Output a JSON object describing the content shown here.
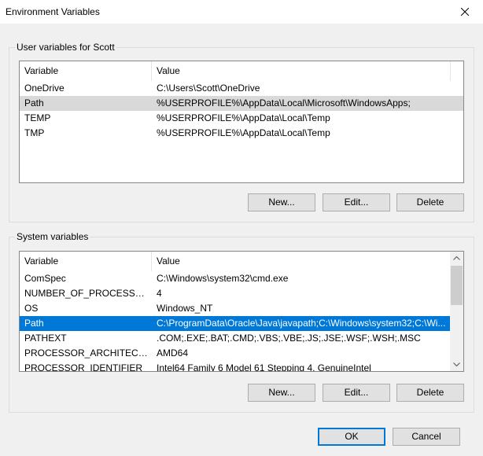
{
  "window": {
    "title": "Environment Variables"
  },
  "user_group": {
    "label": "User variables for Scott",
    "columns": [
      "Variable",
      "Value"
    ],
    "rows": [
      {
        "variable": "OneDrive",
        "value": "C:\\Users\\Scott\\OneDrive"
      },
      {
        "variable": "Path",
        "value": "%USERPROFILE%\\AppData\\Local\\Microsoft\\WindowsApps;"
      },
      {
        "variable": "TEMP",
        "value": "%USERPROFILE%\\AppData\\Local\\Temp"
      },
      {
        "variable": "TMP",
        "value": "%USERPROFILE%\\AppData\\Local\\Temp"
      }
    ],
    "selected_row": 1,
    "buttons": {
      "new": "New...",
      "edit": "Edit...",
      "delete": "Delete"
    }
  },
  "system_group": {
    "label": "System variables",
    "columns": [
      "Variable",
      "Value"
    ],
    "rows": [
      {
        "variable": "ComSpec",
        "value": "C:\\Windows\\system32\\cmd.exe"
      },
      {
        "variable": "NUMBER_OF_PROCESSORS",
        "value": "4"
      },
      {
        "variable": "OS",
        "value": "Windows_NT"
      },
      {
        "variable": "Path",
        "value": "C:\\ProgramData\\Oracle\\Java\\javapath;C:\\Windows\\system32;C:\\Wi..."
      },
      {
        "variable": "PATHEXT",
        "value": ".COM;.EXE;.BAT;.CMD;.VBS;.VBE;.JS;.JSE;.WSF;.WSH;.MSC"
      },
      {
        "variable": "PROCESSOR_ARCHITECTURE",
        "value": "AMD64"
      },
      {
        "variable": "PROCESSOR_IDENTIFIER",
        "value": "Intel64 Family 6 Model 61 Stepping 4, GenuineIntel"
      }
    ],
    "selected_row": 3,
    "buttons": {
      "new": "New...",
      "edit": "Edit...",
      "delete": "Delete"
    }
  },
  "dialog_buttons": {
    "ok": "OK",
    "cancel": "Cancel"
  },
  "icons": {
    "close": "close-icon",
    "scroll_up": "chevron-up-icon",
    "scroll_down": "chevron-down-icon"
  },
  "colors": {
    "selection_blue": "#0078d7",
    "selection_grey": "#d9d9d9",
    "dialog_bg": "#f0f0f0"
  }
}
